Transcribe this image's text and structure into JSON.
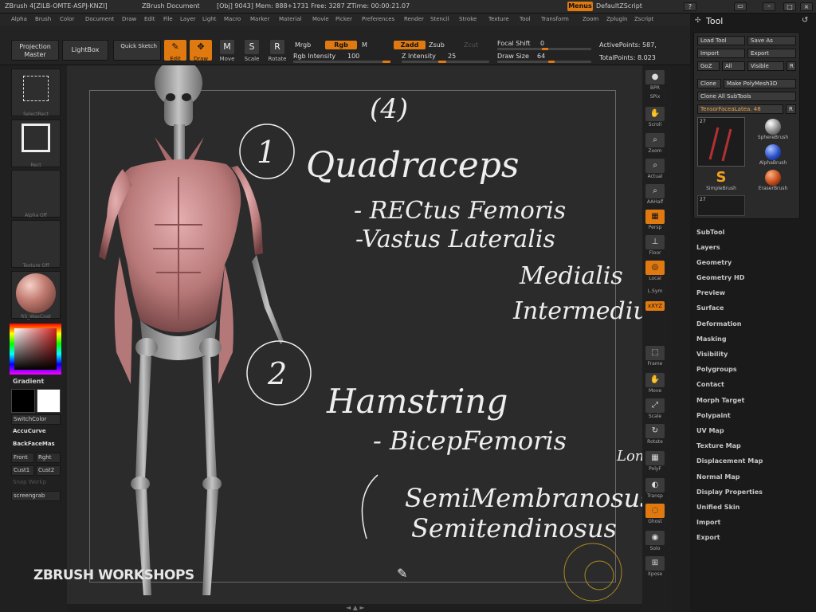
{
  "title_bar": {
    "app": "ZBrush 4[ZILB-OMTE-ASPJ-KNZI]",
    "document": "ZBrush Document",
    "stats": "[Obj] 9043]  Mem: 888+1731  Free: 3287  ZTime: 00:00:21.07",
    "menus_button": "Menus",
    "script_label": "DefaultZScript"
  },
  "menu_bar": [
    "Alpha",
    "Brush",
    "Color",
    "Document",
    "Draw",
    "Edit",
    "File",
    "Layer",
    "Light",
    "Macro",
    "Marker",
    "Material",
    "Movie",
    "Picker",
    "Preferences",
    "Render",
    "Stencil",
    "Stroke",
    "Texture",
    "Tool",
    "Transform",
    "Zoom",
    "Zplugin",
    "Zscript"
  ],
  "shelf": {
    "projection_master": "Projection Master",
    "lightbox": "LightBox",
    "quick_sketch": "Quick Sketch",
    "edit": "Edit",
    "draw": "Draw",
    "move": "Move",
    "scale": "Scale",
    "rotate": "Rotate",
    "mrgb": "Mrgb",
    "rgb": "Rgb",
    "m": "M",
    "rgb_intensity_label": "Rgb Intensity",
    "rgb_intensity_value": "100",
    "zadd": "Zadd",
    "zsub": "Zsub",
    "zcut": "Zcut",
    "z_intensity_label": "Z Intensity",
    "z_intensity_value": "25",
    "focal_shift_label": "Focal Shift",
    "focal_shift_value": "0",
    "draw_size_label": "Draw Size",
    "draw_size_value": "64",
    "active_points": "ActivePoints: 587,",
    "total_points": "TotalPoints: 8.023"
  },
  "left_tray": {
    "select_rect": "SelectRect",
    "rect": "Rect",
    "alpha_off": "Alpha Off",
    "texture_off": "Texture Off",
    "material": "RS_WaxCoat",
    "gradient": "Gradient",
    "switch_color": "SwitchColor",
    "buttons": [
      "AccuCurve",
      "BackFaceMas",
      "Front",
      "Rght",
      "Cust1",
      "Cust2",
      "Snap Workp",
      "screengrab"
    ]
  },
  "right_shelf": [
    "BPR",
    "SPix",
    "Scroll",
    "Zoom",
    "Actual",
    "AAHalf",
    "Persp",
    "Floor",
    "Local",
    "L.Sym",
    "xXYZ",
    "Frame",
    "Move",
    "Scale",
    "Rotate",
    "PolyF",
    "Transp",
    "Ghost",
    "Solo",
    "Xpose"
  ],
  "tool_palette": {
    "title": "Tool",
    "buttons": {
      "load_tool": "Load Tool",
      "save_as": "Save As",
      "import": "Import",
      "export": "Export",
      "goz": "GoZ",
      "all": "All",
      "visible": "Visible",
      "r": "R",
      "clone": "Clone",
      "make_polymesh": "Make PolyMesh3D",
      "clone_all": "Clone All SubTools",
      "current_tool": "TensorFaceaLatea. 48"
    },
    "thumb_count_1": "27",
    "thumb_count_2": "27",
    "brushes": [
      "SphereBrush",
      "AlphaBrush",
      "SimpleBrush",
      "EraserBrush"
    ],
    "sections": [
      "SubTool",
      "Layers",
      "Geometry",
      "Geometry HD",
      "Preview",
      "Surface",
      "Deformation",
      "Masking",
      "Visibility",
      "Polygroups",
      "Contact",
      "Morph Target",
      "Polypaint",
      "UV Map",
      "Texture Map",
      "Displacement Map",
      "Normal Map",
      "Display Properties",
      "Unified Skin",
      "Import",
      "Export"
    ]
  },
  "canvas": {
    "watermark": "ZBRUSH WORKSHOPS",
    "notes": {
      "n4": "(4)",
      "n1": "1",
      "quadriceps": "Quadraceps",
      "rectus": "- RECtus Femoris",
      "vastus": "-Vastus Lateralis",
      "medialis": "Medialis",
      "intermedius": "Intermedius",
      "n2": "2",
      "hamstring": "Hamstring",
      "biceps": "- BicepFemoris",
      "long_short": "Long Short",
      "semimembranosus": "SemiMembranosus",
      "semitendinosus": "Semitendinosus"
    }
  },
  "colors": {
    "accent": "#e07a10",
    "bg": "#1e1e1e",
    "canvas": "#2b2b2b",
    "muscle": "#c98a8a",
    "bone": "#a8a8a8"
  }
}
